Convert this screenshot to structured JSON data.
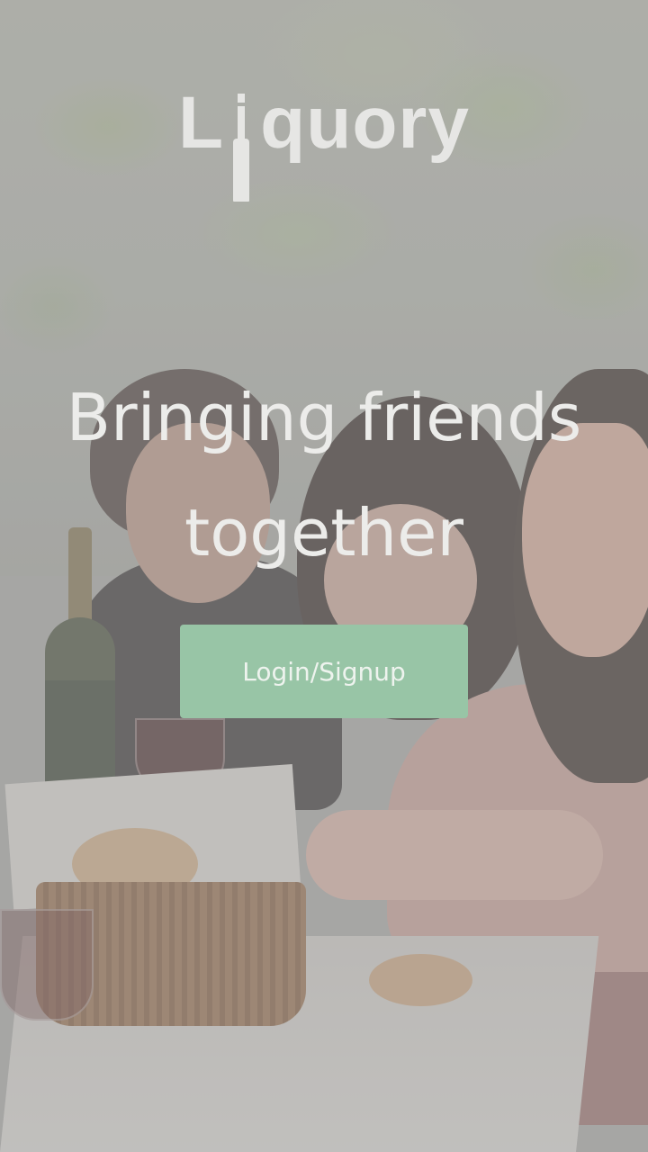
{
  "app": {
    "logo_prefix": "L",
    "logo_suffix": "quory",
    "logo_icon": "bottle-icon"
  },
  "hero": {
    "headline_line1": "Bringing friends",
    "headline_line2": "together"
  },
  "actions": {
    "login_signup_label": "Login/Signup"
  },
  "colors": {
    "accent_button": "#98c5a6",
    "text_light": "#ececea"
  }
}
